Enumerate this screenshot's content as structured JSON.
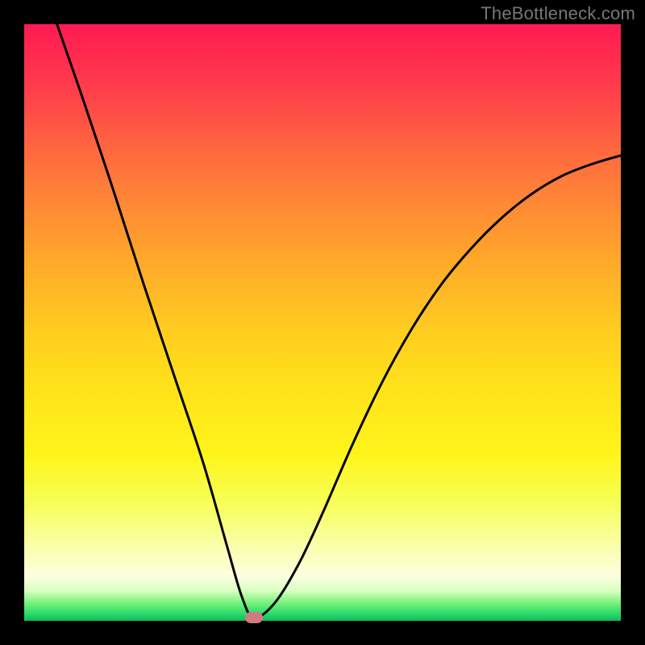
{
  "watermark": "TheBottleneck.com",
  "chart_data": {
    "type": "line",
    "title": "",
    "xlabel": "",
    "ylabel": "",
    "xlim": [
      0,
      1
    ],
    "ylim": [
      0,
      1
    ],
    "marker": {
      "x": 0.385,
      "y": 0.005
    },
    "series": [
      {
        "name": "curve",
        "x": [
          0.055,
          0.1,
          0.15,
          0.2,
          0.25,
          0.3,
          0.34,
          0.365,
          0.385,
          0.42,
          0.46,
          0.5,
          0.55,
          0.6,
          0.65,
          0.7,
          0.75,
          0.8,
          0.85,
          0.9,
          0.95,
          1.0
        ],
        "y": [
          1.0,
          0.87,
          0.72,
          0.565,
          0.415,
          0.265,
          0.125,
          0.04,
          0.005,
          0.03,
          0.095,
          0.18,
          0.295,
          0.4,
          0.49,
          0.565,
          0.625,
          0.675,
          0.715,
          0.745,
          0.765,
          0.78
        ]
      }
    ],
    "background_gradient": {
      "top": "#ff1a52",
      "mid": "#ffe41a",
      "bottom": "#0fb85c"
    }
  }
}
